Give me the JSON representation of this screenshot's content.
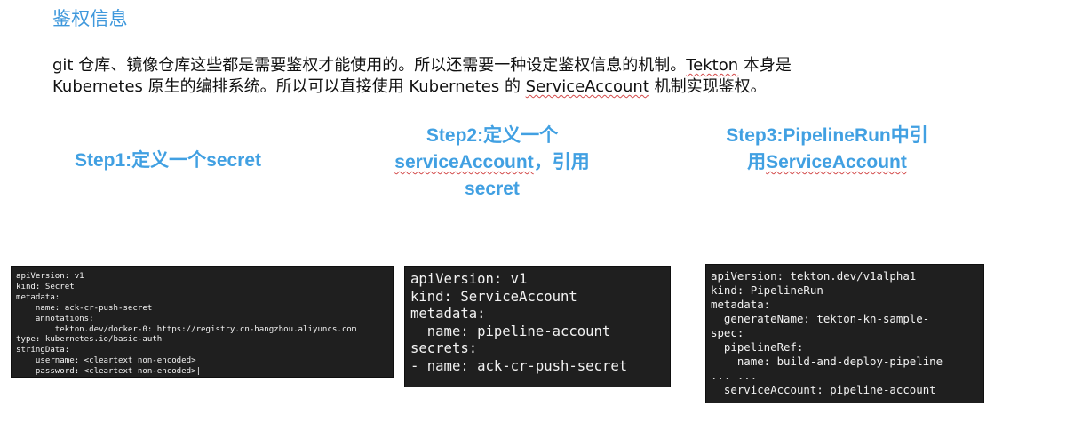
{
  "doc": {
    "title": "鉴权信息",
    "intro": {
      "line1_text_a": "git 仓库、镜像仓库这些都是需要鉴权才能使用的。所以还需要一种设定鉴权信息的机制。",
      "line1_text_b": "Tekton",
      "line1_text_c": " 本身是",
      "line2_text_a": "Kubernetes 原生的编排系统。所以可以直接使用 Kubernetes 的 ",
      "line2_text_b": "ServiceAccount",
      "line2_text_c": " 机制实现鉴权。"
    }
  },
  "steps": {
    "step1": {
      "line1": "Step1:定义一个secret"
    },
    "step2": {
      "line1": "Step2:定义一个",
      "line2_text_a": "serviceAccount",
      "line2_text_b": "，引用",
      "line3": "secret"
    },
    "step3": {
      "line1": "Step3:PipelineRun中引",
      "line2_text_a": "用",
      "line2_text_b": "ServiceAccount"
    }
  },
  "code_blocks": {
    "secret_yaml": "apiVersion: v1\nkind: Secret\nmetadata:\n    name: ack-cr-push-secret\n    annotations:\n        tekton.dev/docker-0: https://registry.cn-hangzhou.aliyuncs.com\ntype: kubernetes.io/basic-auth\nstringData:\n    username: <cleartext non-encoded>\n    password: <cleartext non-encoded>|",
    "service_account_yaml": "apiVersion: v1\nkind: ServiceAccount\nmetadata:\n  name: pipeline-account\nsecrets:\n- name: ack-cr-push-secret",
    "pipelinerun_yaml": "apiVersion: tekton.dev/v1alpha1\nkind: PipelineRun\nmetadata:\n  generateName: tekton-kn-sample-\nspec:\n  pipelineRef:\n    name: build-and-deploy-pipeline\n... ...\n  serviceAccount: pipeline-account"
  },
  "colors": {
    "title": "#3f98dc",
    "step_heading": "#41a0e2",
    "body_text": "#111111",
    "code_background": "#1f1f1f",
    "code_text": "#f2f2f2",
    "spellcheck_underline": "#d34a4a"
  }
}
